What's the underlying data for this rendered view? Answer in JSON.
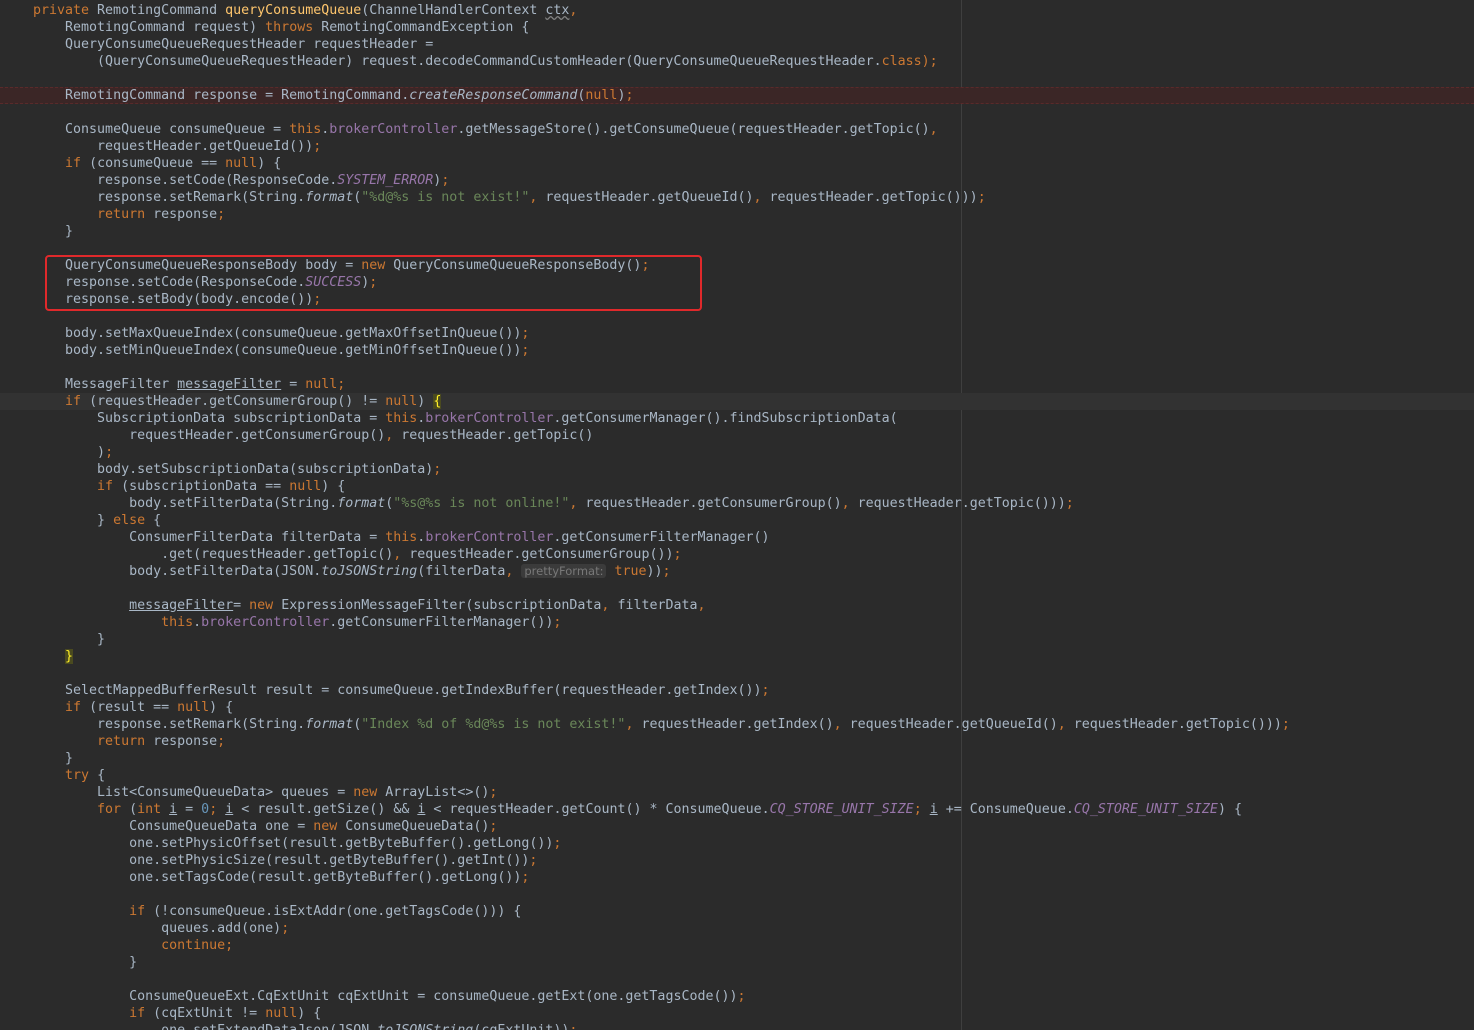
{
  "editor": {
    "theme_colors": {
      "background": "#2b2b2b",
      "default": "#a9b7c6",
      "keyword": "#cc7832",
      "method_decl": "#ffc66d",
      "string": "#6a8759",
      "field": "#9876aa",
      "annotation_box": "#e0292b"
    },
    "lines": [
      {
        "indent": 0,
        "tokens": [
          [
            "kw",
            "private "
          ],
          [
            "",
            "RemotingCommand "
          ],
          [
            "fn",
            "queryConsumeQueue"
          ],
          [
            "",
            "(ChannelHandlerContext "
          ],
          [
            "squig",
            "ctx"
          ],
          [
            "kw",
            ","
          ]
        ]
      },
      {
        "indent": 1,
        "tokens": [
          [
            "",
            "RemotingCommand request) "
          ],
          [
            "kw",
            "throws "
          ],
          [
            "",
            "RemotingCommandException {"
          ]
        ]
      },
      {
        "indent": 1,
        "tokens": [
          [
            "",
            "QueryConsumeQueueRequestHeader requestHeader ="
          ]
        ]
      },
      {
        "indent": 2,
        "tokens": [
          [
            "",
            "(QueryConsumeQueueRequestHeader) request.decodeCommandCustomHeader(QueryConsumeQueueRequestHeader."
          ],
          [
            "kw",
            "class"
          ],
          [
            "kw",
            ");"
          ]
        ]
      },
      {
        "indent": 0,
        "tokens": []
      },
      {
        "indent": 1,
        "hl": "error",
        "tokens": [
          [
            "",
            "RemotingCommand response = RemotingCommand."
          ],
          [
            "italic",
            "createResponseCommand"
          ],
          [
            "",
            "("
          ],
          [
            "kw",
            "null"
          ],
          [
            "",
            ")"
          ],
          [
            "kw",
            ";"
          ]
        ]
      },
      {
        "indent": 0,
        "tokens": []
      },
      {
        "indent": 1,
        "tokens": [
          [
            "",
            "ConsumeQueue consumeQueue = "
          ],
          [
            "kw",
            "this"
          ],
          [
            "",
            "."
          ],
          [
            "field",
            "brokerController"
          ],
          [
            "",
            ".getMessageStore().getConsumeQueue(requestHeader.getTopic()"
          ],
          [
            "kw",
            ","
          ]
        ]
      },
      {
        "indent": 2,
        "tokens": [
          [
            "",
            "requestHeader.getQueueId())"
          ],
          [
            "kw",
            ";"
          ]
        ]
      },
      {
        "indent": 1,
        "tokens": [
          [
            "kw",
            "if "
          ],
          [
            "",
            "(consumeQueue == "
          ],
          [
            "kw",
            "null"
          ],
          [
            "",
            ") {"
          ]
        ]
      },
      {
        "indent": 2,
        "tokens": [
          [
            "",
            "response.setCode(ResponseCode."
          ],
          [
            "static",
            "SYSTEM_ERROR"
          ],
          [
            "",
            ")"
          ],
          [
            "kw",
            ";"
          ]
        ]
      },
      {
        "indent": 2,
        "tokens": [
          [
            "",
            "response.setRemark(String."
          ],
          [
            "italic",
            "format"
          ],
          [
            "",
            "("
          ],
          [
            "str",
            "\"%d@%s is not exist!\""
          ],
          [
            "kw",
            ", "
          ],
          [
            "",
            "requestHeader.getQueueId()"
          ],
          [
            "kw",
            ", "
          ],
          [
            "",
            "requestHeader.getTopic()))"
          ],
          [
            "kw",
            ";"
          ]
        ]
      },
      {
        "indent": 2,
        "tokens": [
          [
            "kw",
            "return "
          ],
          [
            "",
            "response"
          ],
          [
            "kw",
            ";"
          ]
        ]
      },
      {
        "indent": 1,
        "tokens": [
          [
            "",
            "}"
          ]
        ]
      },
      {
        "indent": 0,
        "tokens": []
      },
      {
        "indent": 1,
        "tokens": [
          [
            "",
            "QueryConsumeQueueResponseBody body = "
          ],
          [
            "kw",
            "new "
          ],
          [
            "",
            "QueryConsumeQueueResponseBody()"
          ],
          [
            "kw",
            ";"
          ]
        ]
      },
      {
        "indent": 1,
        "tokens": [
          [
            "",
            "response.setCode(ResponseCode."
          ],
          [
            "static",
            "SUCCESS"
          ],
          [
            "",
            ")"
          ],
          [
            "kw",
            ";"
          ]
        ]
      },
      {
        "indent": 1,
        "tokens": [
          [
            "",
            "response.setBody(body.encode())"
          ],
          [
            "kw",
            ";"
          ]
        ]
      },
      {
        "indent": 0,
        "tokens": []
      },
      {
        "indent": 1,
        "tokens": [
          [
            "",
            "body.setMaxQueueIndex(consumeQueue.getMaxOffsetInQueue())"
          ],
          [
            "kw",
            ";"
          ]
        ]
      },
      {
        "indent": 1,
        "tokens": [
          [
            "",
            "body.setMinQueueIndex(consumeQueue.getMinOffsetInQueue())"
          ],
          [
            "kw",
            ";"
          ]
        ]
      },
      {
        "indent": 0,
        "tokens": []
      },
      {
        "indent": 1,
        "tokens": [
          [
            "",
            "MessageFilter "
          ],
          [
            "ul",
            "messageFilter"
          ],
          [
            "",
            " = "
          ],
          [
            "kw",
            "null"
          ],
          [
            "kw",
            ";"
          ]
        ]
      },
      {
        "indent": 1,
        "hl": "caret",
        "tokens": [
          [
            "kw",
            "if "
          ],
          [
            "",
            "(requestHeader.getConsumerGroup() != "
          ],
          [
            "kw",
            "null"
          ],
          [
            "",
            ") "
          ],
          [
            "brace",
            "{"
          ]
        ]
      },
      {
        "indent": 2,
        "tokens": [
          [
            "",
            "SubscriptionData subscriptionData = "
          ],
          [
            "kw",
            "this"
          ],
          [
            "",
            "."
          ],
          [
            "field",
            "brokerController"
          ],
          [
            "",
            ".getConsumerManager().findSubscriptionData("
          ]
        ]
      },
      {
        "indent": 3,
        "tokens": [
          [
            "",
            "requestHeader.getConsumerGroup()"
          ],
          [
            "kw",
            ", "
          ],
          [
            "",
            "requestHeader.getTopic()"
          ]
        ]
      },
      {
        "indent": 2,
        "tokens": [
          [
            "",
            ")"
          ],
          [
            "kw",
            ";"
          ]
        ]
      },
      {
        "indent": 2,
        "tokens": [
          [
            "",
            "body.setSubscriptionData(subscriptionData)"
          ],
          [
            "kw",
            ";"
          ]
        ]
      },
      {
        "indent": 2,
        "tokens": [
          [
            "kw",
            "if "
          ],
          [
            "",
            "(subscriptionData == "
          ],
          [
            "kw",
            "null"
          ],
          [
            "",
            ") {"
          ]
        ]
      },
      {
        "indent": 3,
        "tokens": [
          [
            "",
            "body.setFilterData(String."
          ],
          [
            "italic",
            "format"
          ],
          [
            "",
            "("
          ],
          [
            "str",
            "\"%s@%s is not online!\""
          ],
          [
            "kw",
            ", "
          ],
          [
            "",
            "requestHeader.getConsumerGroup()"
          ],
          [
            "kw",
            ", "
          ],
          [
            "",
            "requestHeader.getTopic()))"
          ],
          [
            "kw",
            ";"
          ]
        ]
      },
      {
        "indent": 2,
        "tokens": [
          [
            "",
            "} "
          ],
          [
            "kw",
            "else "
          ],
          [
            "",
            "{"
          ]
        ]
      },
      {
        "indent": 3,
        "tokens": [
          [
            "",
            "ConsumerFilterData filterData = "
          ],
          [
            "kw",
            "this"
          ],
          [
            "",
            "."
          ],
          [
            "field",
            "brokerController"
          ],
          [
            "",
            ".getConsumerFilterManager()"
          ]
        ]
      },
      {
        "indent": 4,
        "tokens": [
          [
            "",
            ".get(requestHeader.getTopic()"
          ],
          [
            "kw",
            ", "
          ],
          [
            "",
            "requestHeader.getConsumerGroup())"
          ],
          [
            "kw",
            ";"
          ]
        ]
      },
      {
        "indent": 3,
        "tokens": [
          [
            "",
            "body.setFilterData(JSON."
          ],
          [
            "italic",
            "toJSONString"
          ],
          [
            "",
            "(filterData"
          ],
          [
            "kw",
            ", "
          ],
          [
            "hint",
            "prettyFormat:"
          ],
          [
            "kw",
            " true"
          ],
          [
            "",
            "))"
          ],
          [
            "kw",
            ";"
          ]
        ]
      },
      {
        "indent": 0,
        "tokens": []
      },
      {
        "indent": 3,
        "tokens": [
          [
            "ul",
            "messageFilter"
          ],
          [
            "",
            "",
            " "
          ],
          [
            "",
            ""
          ],
          [
            "",
            "= "
          ],
          [
            "kw",
            "new "
          ],
          [
            "",
            "ExpressionMessageFilter(subscriptionData"
          ],
          [
            "kw",
            ", "
          ],
          [
            "",
            "filterData"
          ],
          [
            "kw",
            ","
          ]
        ]
      },
      {
        "indent": 4,
        "tokens": [
          [
            "kw",
            "this"
          ],
          [
            "",
            "."
          ],
          [
            "field",
            "brokerController"
          ],
          [
            "",
            ".getConsumerFilterManager())"
          ],
          [
            "kw",
            ";"
          ]
        ]
      },
      {
        "indent": 2,
        "tokens": [
          [
            "",
            "}"
          ]
        ]
      },
      {
        "indent": 1,
        "tokens": [
          [
            "brace",
            "}"
          ]
        ]
      },
      {
        "indent": 0,
        "tokens": []
      },
      {
        "indent": 1,
        "tokens": [
          [
            "",
            "SelectMappedBufferResult result = consumeQueue.getIndexBuffer(requestHeader.getIndex())"
          ],
          [
            "kw",
            ";"
          ]
        ]
      },
      {
        "indent": 1,
        "tokens": [
          [
            "kw",
            "if "
          ],
          [
            "",
            "(result == "
          ],
          [
            "kw",
            "null"
          ],
          [
            "",
            ") {"
          ]
        ]
      },
      {
        "indent": 2,
        "tokens": [
          [
            "",
            "response.setRemark(String."
          ],
          [
            "italic",
            "format"
          ],
          [
            "",
            "("
          ],
          [
            "str",
            "\"Index %d of %d@%s is not exist!\""
          ],
          [
            "kw",
            ", "
          ],
          [
            "",
            "requestHeader.getIndex()"
          ],
          [
            "kw",
            ", "
          ],
          [
            "",
            "requestHeader.getQueueId()"
          ],
          [
            "kw",
            ", "
          ],
          [
            "",
            "requestHeader.getTopic()))"
          ],
          [
            "kw",
            ";"
          ]
        ]
      },
      {
        "indent": 2,
        "tokens": [
          [
            "kw",
            "return "
          ],
          [
            "",
            "response"
          ],
          [
            "kw",
            ";"
          ]
        ]
      },
      {
        "indent": 1,
        "tokens": [
          [
            "",
            "}"
          ]
        ]
      },
      {
        "indent": 1,
        "tokens": [
          [
            "kw",
            "try "
          ],
          [
            "",
            "{"
          ]
        ]
      },
      {
        "indent": 2,
        "tokens": [
          [
            "",
            "List<ConsumeQueueData> queues = "
          ],
          [
            "kw",
            "new "
          ],
          [
            "",
            "ArrayList<>()"
          ],
          [
            "kw",
            ";"
          ]
        ]
      },
      {
        "indent": 2,
        "tokens": [
          [
            "kw",
            "for "
          ],
          [
            "",
            "("
          ],
          [
            "kw",
            "int "
          ],
          [
            "ul",
            "i"
          ],
          [
            "",
            " = "
          ],
          [
            "num",
            "0"
          ],
          [
            "kw",
            "; "
          ],
          [
            "ul",
            "i"
          ],
          [
            "",
            " < result.getSize() && "
          ],
          [
            "ul",
            "i"
          ],
          [
            "",
            " < requestHeader.getCount() * ConsumeQueue."
          ],
          [
            "static",
            "CQ_STORE_UNIT_SIZE"
          ],
          [
            "kw",
            "; "
          ],
          [
            "ul",
            "i"
          ],
          [
            "",
            " += ConsumeQueue."
          ],
          [
            "static",
            "CQ_STORE_UNIT_SIZE"
          ],
          [
            "",
            ") {"
          ]
        ]
      },
      {
        "indent": 3,
        "tokens": [
          [
            "",
            "ConsumeQueueData one = "
          ],
          [
            "kw",
            "new "
          ],
          [
            "",
            "ConsumeQueueData()"
          ],
          [
            "kw",
            ";"
          ]
        ]
      },
      {
        "indent": 3,
        "tokens": [
          [
            "",
            "one.setPhysicOffset(result.getByteBuffer().getLong())"
          ],
          [
            "kw",
            ";"
          ]
        ]
      },
      {
        "indent": 3,
        "tokens": [
          [
            "",
            "one.setPhysicSize(result.getByteBuffer().getInt())"
          ],
          [
            "kw",
            ";"
          ]
        ]
      },
      {
        "indent": 3,
        "tokens": [
          [
            "",
            "one.setTagsCode(result.getByteBuffer().getLong())"
          ],
          [
            "kw",
            ";"
          ]
        ]
      },
      {
        "indent": 0,
        "tokens": []
      },
      {
        "indent": 3,
        "tokens": [
          [
            "kw",
            "if "
          ],
          [
            "",
            "(!consumeQueue.isExtAddr(one.getTagsCode())) {"
          ]
        ]
      },
      {
        "indent": 4,
        "tokens": [
          [
            "",
            "queues.add(one)"
          ],
          [
            "kw",
            ";"
          ]
        ]
      },
      {
        "indent": 4,
        "tokens": [
          [
            "kw",
            "continue;"
          ]
        ]
      },
      {
        "indent": 3,
        "tokens": [
          [
            "",
            "}"
          ]
        ]
      },
      {
        "indent": 0,
        "tokens": []
      },
      {
        "indent": 3,
        "tokens": [
          [
            "",
            "ConsumeQueueExt.CqExtUnit cqExtUnit = consumeQueue.getExt(one.getTagsCode())"
          ],
          [
            "kw",
            ";"
          ]
        ]
      },
      {
        "indent": 3,
        "tokens": [
          [
            "kw",
            "if "
          ],
          [
            "",
            "(cqExtUnit != "
          ],
          [
            "kw",
            "null"
          ],
          [
            "",
            ") {"
          ]
        ]
      },
      {
        "indent": 4,
        "tokens": [
          [
            "",
            "one.setExtendDataJson(JSON."
          ],
          [
            "italic",
            "toJSONString"
          ],
          [
            "",
            "(cqExtUnit))"
          ],
          [
            "kw",
            ";"
          ]
        ]
      }
    ]
  }
}
